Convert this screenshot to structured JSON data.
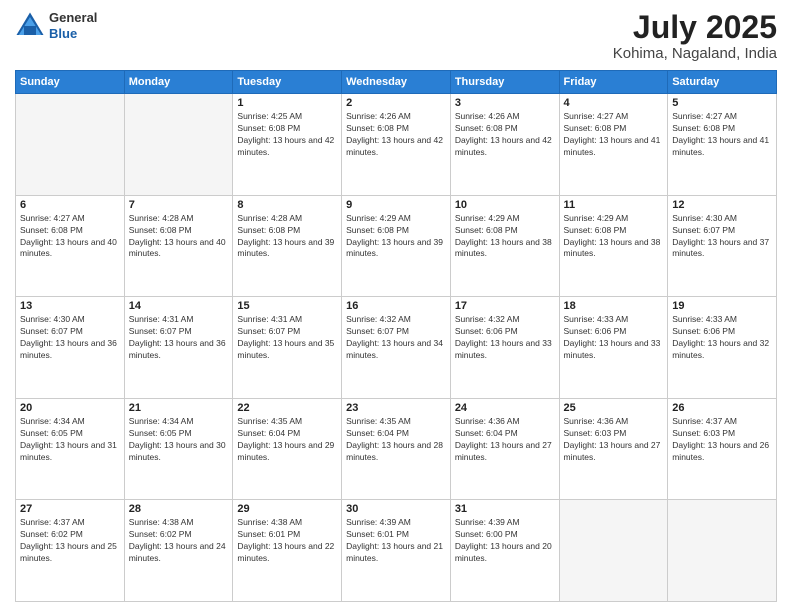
{
  "header": {
    "logo_general": "General",
    "logo_blue": "Blue",
    "title": "July 2025",
    "subtitle": "Kohima, Nagaland, India"
  },
  "weekdays": [
    "Sunday",
    "Monday",
    "Tuesday",
    "Wednesday",
    "Thursday",
    "Friday",
    "Saturday"
  ],
  "weeks": [
    [
      {
        "day": "",
        "empty": true
      },
      {
        "day": "",
        "empty": true
      },
      {
        "day": "1",
        "sunrise": "4:25 AM",
        "sunset": "6:08 PM",
        "daylight": "13 hours and 42 minutes."
      },
      {
        "day": "2",
        "sunrise": "4:26 AM",
        "sunset": "6:08 PM",
        "daylight": "13 hours and 42 minutes."
      },
      {
        "day": "3",
        "sunrise": "4:26 AM",
        "sunset": "6:08 PM",
        "daylight": "13 hours and 42 minutes."
      },
      {
        "day": "4",
        "sunrise": "4:27 AM",
        "sunset": "6:08 PM",
        "daylight": "13 hours and 41 minutes."
      },
      {
        "day": "5",
        "sunrise": "4:27 AM",
        "sunset": "6:08 PM",
        "daylight": "13 hours and 41 minutes."
      }
    ],
    [
      {
        "day": "6",
        "sunrise": "4:27 AM",
        "sunset": "6:08 PM",
        "daylight": "13 hours and 40 minutes."
      },
      {
        "day": "7",
        "sunrise": "4:28 AM",
        "sunset": "6:08 PM",
        "daylight": "13 hours and 40 minutes."
      },
      {
        "day": "8",
        "sunrise": "4:28 AM",
        "sunset": "6:08 PM",
        "daylight": "13 hours and 39 minutes."
      },
      {
        "day": "9",
        "sunrise": "4:29 AM",
        "sunset": "6:08 PM",
        "daylight": "13 hours and 39 minutes."
      },
      {
        "day": "10",
        "sunrise": "4:29 AM",
        "sunset": "6:08 PM",
        "daylight": "13 hours and 38 minutes."
      },
      {
        "day": "11",
        "sunrise": "4:29 AM",
        "sunset": "6:08 PM",
        "daylight": "13 hours and 38 minutes."
      },
      {
        "day": "12",
        "sunrise": "4:30 AM",
        "sunset": "6:07 PM",
        "daylight": "13 hours and 37 minutes."
      }
    ],
    [
      {
        "day": "13",
        "sunrise": "4:30 AM",
        "sunset": "6:07 PM",
        "daylight": "13 hours and 36 minutes."
      },
      {
        "day": "14",
        "sunrise": "4:31 AM",
        "sunset": "6:07 PM",
        "daylight": "13 hours and 36 minutes."
      },
      {
        "day": "15",
        "sunrise": "4:31 AM",
        "sunset": "6:07 PM",
        "daylight": "13 hours and 35 minutes."
      },
      {
        "day": "16",
        "sunrise": "4:32 AM",
        "sunset": "6:07 PM",
        "daylight": "13 hours and 34 minutes."
      },
      {
        "day": "17",
        "sunrise": "4:32 AM",
        "sunset": "6:06 PM",
        "daylight": "13 hours and 33 minutes."
      },
      {
        "day": "18",
        "sunrise": "4:33 AM",
        "sunset": "6:06 PM",
        "daylight": "13 hours and 33 minutes."
      },
      {
        "day": "19",
        "sunrise": "4:33 AM",
        "sunset": "6:06 PM",
        "daylight": "13 hours and 32 minutes."
      }
    ],
    [
      {
        "day": "20",
        "sunrise": "4:34 AM",
        "sunset": "6:05 PM",
        "daylight": "13 hours and 31 minutes."
      },
      {
        "day": "21",
        "sunrise": "4:34 AM",
        "sunset": "6:05 PM",
        "daylight": "13 hours and 30 minutes."
      },
      {
        "day": "22",
        "sunrise": "4:35 AM",
        "sunset": "6:04 PM",
        "daylight": "13 hours and 29 minutes."
      },
      {
        "day": "23",
        "sunrise": "4:35 AM",
        "sunset": "6:04 PM",
        "daylight": "13 hours and 28 minutes."
      },
      {
        "day": "24",
        "sunrise": "4:36 AM",
        "sunset": "6:04 PM",
        "daylight": "13 hours and 27 minutes."
      },
      {
        "day": "25",
        "sunrise": "4:36 AM",
        "sunset": "6:03 PM",
        "daylight": "13 hours and 27 minutes."
      },
      {
        "day": "26",
        "sunrise": "4:37 AM",
        "sunset": "6:03 PM",
        "daylight": "13 hours and 26 minutes."
      }
    ],
    [
      {
        "day": "27",
        "sunrise": "4:37 AM",
        "sunset": "6:02 PM",
        "daylight": "13 hours and 25 minutes."
      },
      {
        "day": "28",
        "sunrise": "4:38 AM",
        "sunset": "6:02 PM",
        "daylight": "13 hours and 24 minutes."
      },
      {
        "day": "29",
        "sunrise": "4:38 AM",
        "sunset": "6:01 PM",
        "daylight": "13 hours and 22 minutes."
      },
      {
        "day": "30",
        "sunrise": "4:39 AM",
        "sunset": "6:01 PM",
        "daylight": "13 hours and 21 minutes."
      },
      {
        "day": "31",
        "sunrise": "4:39 AM",
        "sunset": "6:00 PM",
        "daylight": "13 hours and 20 minutes."
      },
      {
        "day": "",
        "empty": true
      },
      {
        "day": "",
        "empty": true
      }
    ]
  ]
}
